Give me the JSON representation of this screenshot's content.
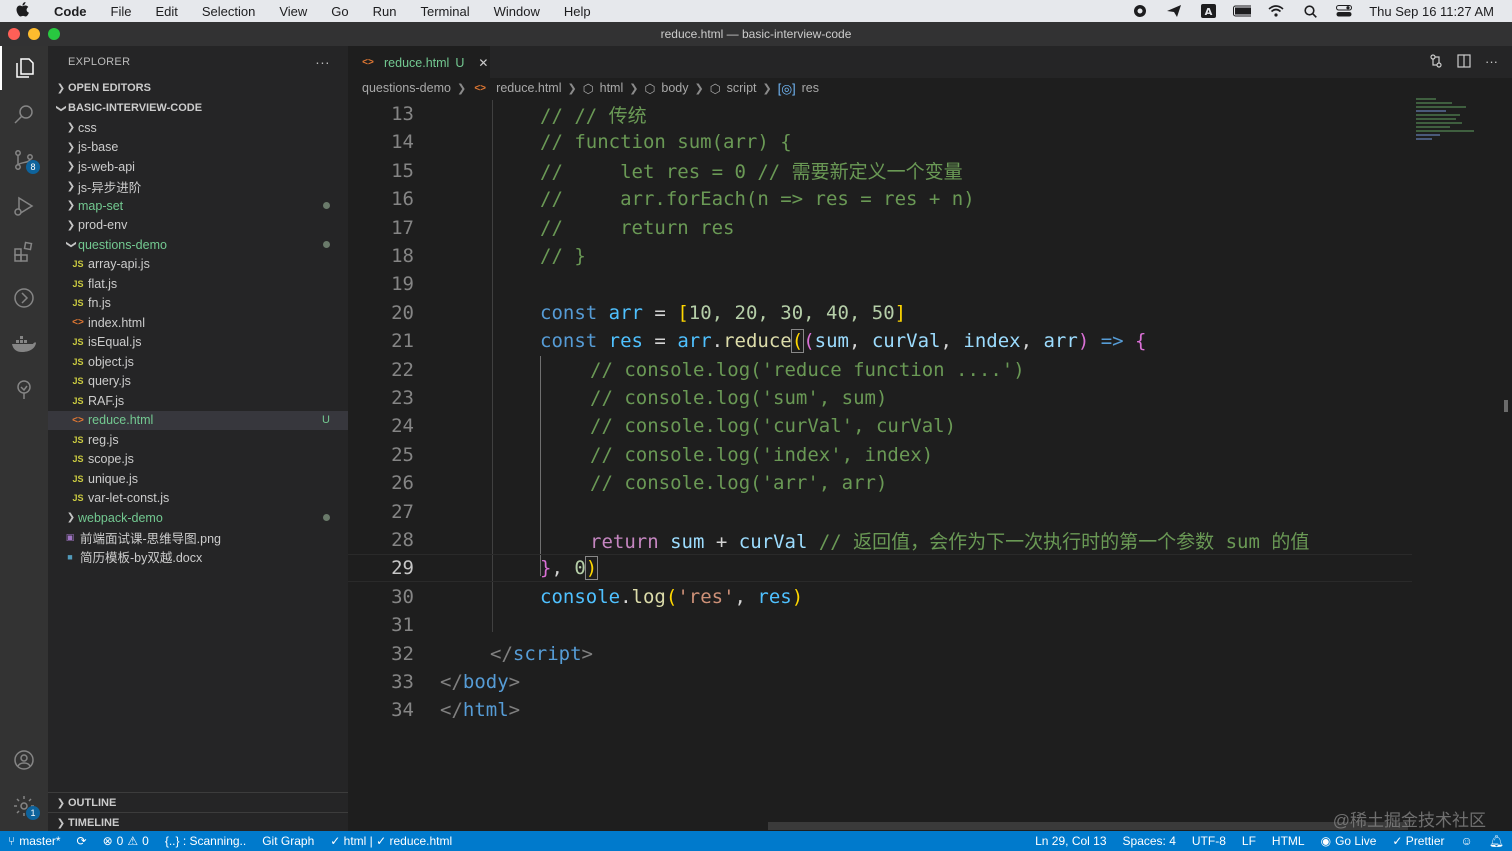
{
  "menubar": {
    "app": "Code",
    "items": [
      "File",
      "Edit",
      "Selection",
      "View",
      "Go",
      "Run",
      "Terminal",
      "Window",
      "Help"
    ],
    "clock": "Thu Sep 16  11:27 AM"
  },
  "window": {
    "title": "reduce.html — basic-interview-code"
  },
  "activity": {
    "scm_badge": "8",
    "settings_badge": "1"
  },
  "explorer": {
    "header": "EXPLORER",
    "more": "···",
    "open_editors": "OPEN EDITORS",
    "root": "BASIC-INTERVIEW-CODE",
    "folders_top": [
      {
        "label": "css"
      },
      {
        "label": "js-base"
      },
      {
        "label": "js-web-api"
      },
      {
        "label": "js-异步进阶"
      },
      {
        "label": "map-set"
      },
      {
        "label": "prod-env"
      }
    ],
    "open_folder": "questions-demo",
    "files": [
      {
        "label": "array-api.js",
        "type": "JS"
      },
      {
        "label": "flat.js",
        "type": "JS"
      },
      {
        "label": "fn.js",
        "type": "JS"
      },
      {
        "label": "index.html",
        "type": "<>"
      },
      {
        "label": "isEqual.js",
        "type": "JS"
      },
      {
        "label": "object.js",
        "type": "JS"
      },
      {
        "label": "query.js",
        "type": "JS"
      },
      {
        "label": "RAF.js",
        "type": "JS"
      },
      {
        "label": "reduce.html",
        "type": "<>",
        "status": "U"
      },
      {
        "label": "reg.js",
        "type": "JS"
      },
      {
        "label": "scope.js",
        "type": "JS"
      },
      {
        "label": "unique.js",
        "type": "JS"
      },
      {
        "label": "var-let-const.js",
        "type": "JS"
      }
    ],
    "folder_after": "webpack-demo",
    "root_files": [
      {
        "label": "前端面试课-思维导图.png",
        "type": "img"
      },
      {
        "label": "简历模板-by双越.docx",
        "type": "doc"
      }
    ],
    "outline": "OUTLINE",
    "timeline": "TIMELINE"
  },
  "tab": {
    "label": "reduce.html",
    "status": "U",
    "close": "✕"
  },
  "breadcrumb": [
    "questions-demo",
    "reduce.html",
    "html",
    "body",
    "script",
    "res"
  ],
  "code_lines": [
    13,
    14,
    15,
    16,
    17,
    18,
    19,
    20,
    21,
    22,
    23,
    24,
    25,
    26,
    27,
    28,
    29,
    30,
    31,
    32,
    33,
    34
  ],
  "code": {
    "l13": "// // 传统",
    "l14": "// function sum(arr) {",
    "l15": "//     let res = 0 // 需要新定义一个变量",
    "l16": "//     arr.forEach(n => res = res + n)",
    "l17": "//     return res",
    "l18": "// }",
    "l20": {
      "const": "const",
      "arr": "arr",
      "eq": " = ",
      "open": "[",
      "nums": "10, 20, 30, 40, 50",
      "close": "]"
    },
    "l21": {
      "const": "const",
      "res": "res",
      "eq": " = ",
      "arr": "arr",
      "dot": ".",
      "fn": "reduce",
      "p1": "(",
      "p2": "(",
      "params": [
        "sum",
        "curVal",
        "index",
        "arr"
      ],
      "comma": ", ",
      "p3": ")",
      "arrow": " => ",
      "brace": "{"
    },
    "l22": "// console.log('reduce function ....')",
    "l23": "// console.log('sum', sum)",
    "l24": "// console.log('curVal', curVal)",
    "l25": "// console.log('index', index)",
    "l26": "// console.log('arr', arr)",
    "l28": {
      "ret": "return",
      "sum": "sum",
      "plus": " + ",
      "cur": "curVal",
      "comment": "// 返回值，会作为下一次执行时的第一个参数 sum 的值"
    },
    "l29": {
      "brace": "}",
      "comma": ", ",
      "zero": "0",
      "paren": ")"
    },
    "l30": {
      "console": "console",
      "dot": ".",
      "log": "log",
      "open": "(",
      "str": "'res'",
      "comma": ", ",
      "res": "res",
      "close": ")"
    },
    "l32": {
      "open": "</",
      "tag": "script",
      "close": ">"
    },
    "l33": {
      "open": "</",
      "tag": "body",
      "close": ">"
    },
    "l34": {
      "open": "</",
      "tag": "html",
      "close": ">"
    }
  },
  "status": {
    "branch": "master*",
    "sync": "⟳",
    "errors": "0",
    "warnings": "0",
    "scanning": "{..} : Scanning..",
    "git_graph": "Git Graph",
    "html_check": "✓ html | ✓ reduce.html",
    "position": "Ln 29, Col 13",
    "spaces": "Spaces: 4",
    "encoding": "UTF-8",
    "eol": "LF",
    "language": "HTML",
    "golive": "Go Live",
    "prettier": "✓ Prettier"
  },
  "watermark": "@稀土掘金技术社区",
  "colors": {
    "accent": "#007acc",
    "added": "#73c991",
    "comment": "#6a9955",
    "keyword": "#569cd6"
  }
}
